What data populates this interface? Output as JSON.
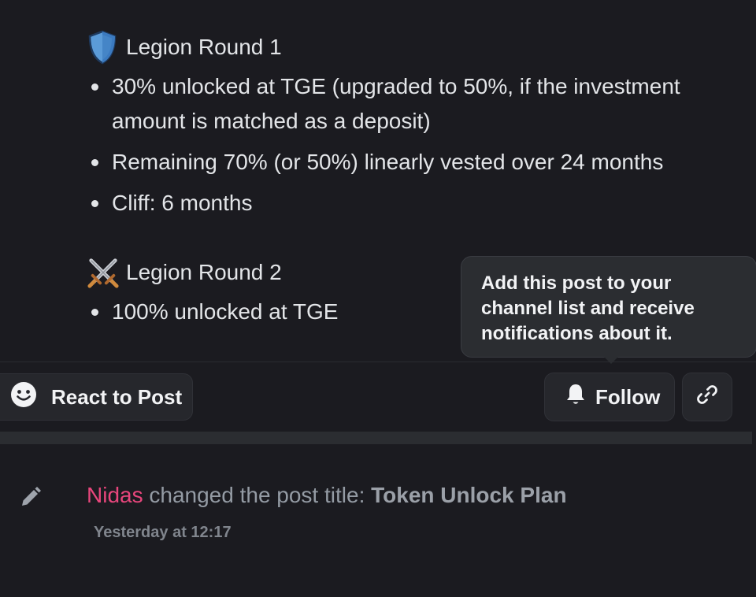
{
  "post": {
    "round1": {
      "title": "Legion Round 1",
      "icon": "shield-icon",
      "bullets": [
        "30% unlocked at TGE (upgraded to 50%, if the investment amount is matched as a deposit)",
        "Remaining 70% (or 50%) linearly vested over 24 months",
        "Cliff: 6 months"
      ]
    },
    "round2": {
      "title": "Legion Round 2",
      "icon": "crossed-swords-icon",
      "bullets": [
        "100% unlocked at TGE"
      ]
    }
  },
  "tooltip": {
    "text": "Add this post to your channel list and receive notifications about it."
  },
  "actions": {
    "react_label": "React to Post",
    "follow_label": "Follow",
    "react_icon": "smiley-face-icon",
    "follow_icon": "bell-icon",
    "link_icon": "link-icon"
  },
  "system_message": {
    "icon": "pencil-icon",
    "user": "Nidas",
    "action_text": " changed the post title: ",
    "new_title": "Token Unlock Plan",
    "timestamp": "Yesterday at 12:17"
  },
  "colors": {
    "background": "#1b1b20",
    "username": "#e8467c",
    "tooltip_bg": "#2b2d31",
    "button_bg": "#26272c"
  }
}
